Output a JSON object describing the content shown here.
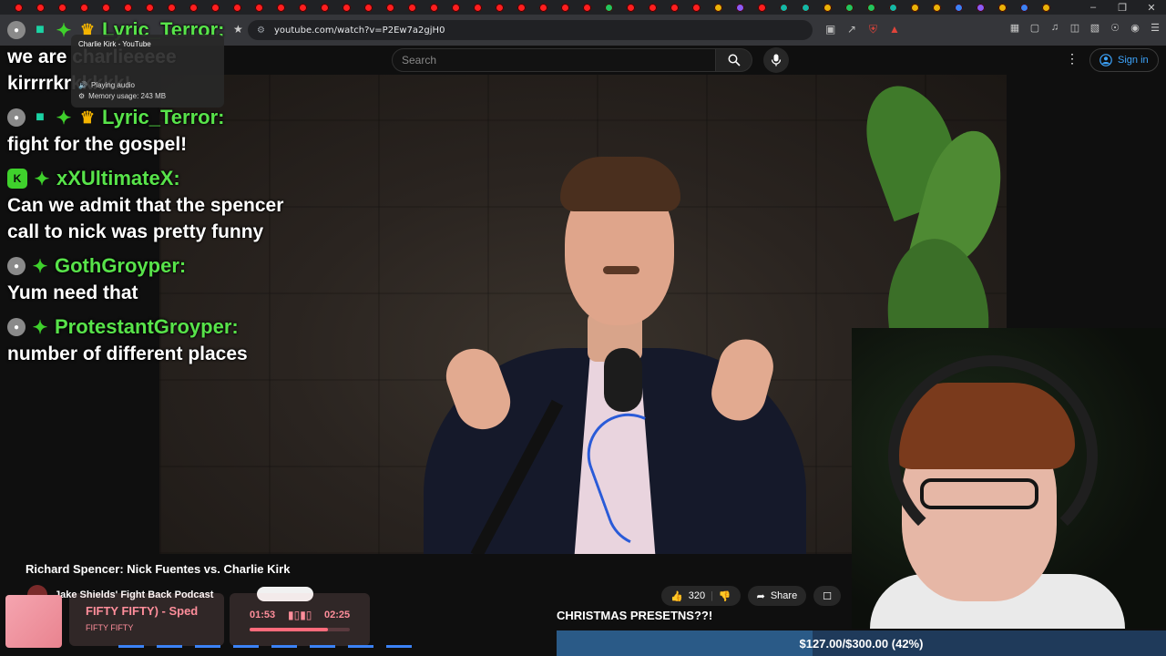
{
  "browser": {
    "url": "youtube.com/watch?v=P2Ew7a2gjH0",
    "tab_tooltip": {
      "title": "Charlie Kirk - YouTube",
      "status": "Playing audio",
      "memory": "Memory usage: 243 MB"
    }
  },
  "youtube": {
    "search_placeholder": "Search",
    "sign_in": "Sign in",
    "video_title": "Richard Spencer: Nick Fuentes vs. Charlie Kirk",
    "channel": "Jake Shields' Fight Back Podcast",
    "likes": "320",
    "share": "Share"
  },
  "chat": [
    {
      "user": "Lyric_Terror:",
      "badges": [
        "avatar",
        "gift",
        "diamond",
        "crown"
      ],
      "text": "we are charlieeeee kirrrrkrkkkkk!"
    },
    {
      "user": "Lyric_Terror:",
      "badges": [
        "avatar",
        "gift",
        "diamond",
        "crown"
      ],
      "text": "fight for the gospel!"
    },
    {
      "user": "xXUltimateX:",
      "badges": [
        "k",
        "diamond"
      ],
      "text": "Can we admit that the spencer call to nick was pretty funny"
    },
    {
      "user": "GothGroyper:",
      "badges": [
        "avatar",
        "diamond"
      ],
      "text": "Yum need that"
    },
    {
      "user": "ProtestantGroyper:",
      "badges": [
        "avatar",
        "diamond"
      ],
      "text": "number of different places"
    }
  ],
  "music": {
    "track": "FIFTY FIFTY) - Sped",
    "artist": "FIFTY FIFTY",
    "current_time": "01:53",
    "duration": "02:25",
    "progress_fraction": 0.78
  },
  "overlay": {
    "announcement": "CHRISTMAS PRESETNS??!",
    "goal_text": "$127.00/$300.00 (42%)",
    "goal_fraction": 0.42
  },
  "colors": {
    "chat_username": "#58e34a",
    "goal_bar": "#1f3a5a",
    "goal_fill": "#2a5a87",
    "music_accent": "#ff8e9b"
  }
}
